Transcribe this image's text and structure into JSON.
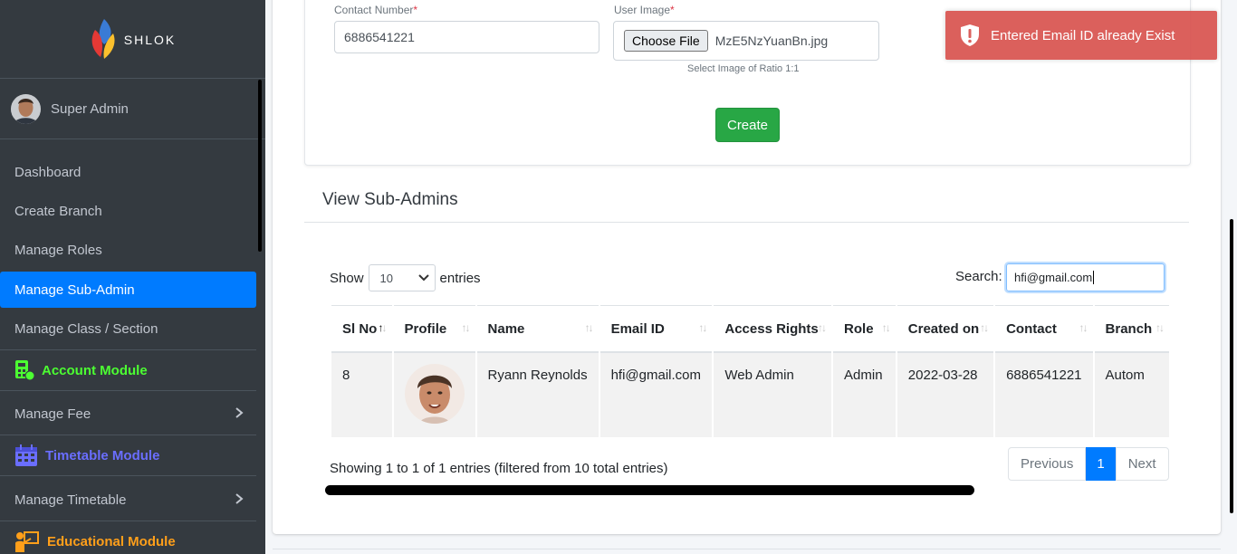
{
  "brand": {
    "name": "SHLOK"
  },
  "user": {
    "name": "Super Admin"
  },
  "nav": {
    "dashboard": "Dashboard",
    "create_branch": "Create Branch",
    "manage_roles": "Manage Roles",
    "manage_sub_admin": "Manage Sub-Admin",
    "manage_class_section": "Manage Class / Section",
    "account_module": "Account Module",
    "manage_fee": "Manage Fee",
    "timetable_module": "Timetable Module",
    "manage_timetable": "Manage Timetable",
    "educational_module": "Educational Module"
  },
  "colors": {
    "account_module": "#4cff32",
    "timetable_module": "#6a6eff",
    "educational_module": "#ff9f1a",
    "active_nav": "#007bff",
    "create_button": "#28a745",
    "toast": "#d9534f"
  },
  "form": {
    "contact_label": "Contact Number",
    "contact_value": "6886541221",
    "image_label": "User Image",
    "required_mark": "*",
    "choose_file": "Choose File",
    "file_name": "MzE5NzYuanBn.jpg",
    "image_hint": "Select Image of Ratio 1:1",
    "create_button": "Create"
  },
  "list": {
    "title": "View Sub-Admins",
    "show_label": "Show",
    "entries_label": "entries",
    "page_size": "10",
    "search_label": "Search:",
    "search_value": "hfi@gmail.com",
    "columns": [
      "Sl No",
      "Profile",
      "Name",
      "Email ID",
      "Access Rights",
      "Role",
      "Created on",
      "Contact",
      "Branch"
    ],
    "rows": [
      {
        "sl": "8",
        "name": "Ryann Reynolds",
        "email": "hfi@gmail.com",
        "access": "Web Admin",
        "role": "Admin",
        "created": "2022-03-28",
        "contact": "6886541221",
        "branch": "Autom"
      }
    ],
    "info": "Showing 1 to 1 of 1 entries (filtered from 10 total entries)",
    "pagination": {
      "previous": "Previous",
      "current": "1",
      "next": "Next"
    }
  },
  "toast": {
    "message": "Entered Email ID already Exist",
    "icon": "shield-alert-icon"
  }
}
